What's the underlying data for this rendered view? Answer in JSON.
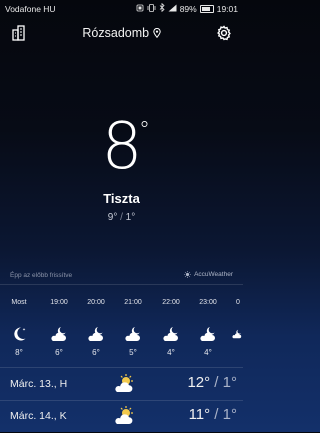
{
  "status": {
    "carrier": "Vodafone HU",
    "battery": "89%",
    "time": "19:01",
    "icons": [
      "notification-icon",
      "vibrate-icon",
      "bluetooth-icon",
      "signal-icon",
      "battery-icon"
    ]
  },
  "header": {
    "location": "Rózsadomb",
    "icons": [
      "cityscape-icon",
      "location-pin-icon",
      "settings-gear-icon"
    ]
  },
  "current": {
    "temp": "8",
    "deg": "°",
    "condition": "Tiszta",
    "high": "9°",
    "low": "1°"
  },
  "updated": "Épp az előbb frissítve",
  "provider": "AccuWeather",
  "hourly": [
    {
      "time": "Most",
      "icon": "moon-icon",
      "temp": "8°"
    },
    {
      "time": "19:00",
      "icon": "cloudy-night-icon",
      "temp": "6°"
    },
    {
      "time": "20:00",
      "icon": "cloudy-night-icon",
      "temp": "6°"
    },
    {
      "time": "21:00",
      "icon": "cloudy-night-icon",
      "temp": "5°"
    },
    {
      "time": "22:00",
      "icon": "cloudy-night-icon",
      "temp": "4°"
    },
    {
      "time": "23:00",
      "icon": "cloudy-night-icon",
      "temp": "4°"
    },
    {
      "time": "0",
      "icon": "cloudy-night-icon",
      "temp": ""
    }
  ],
  "daily": [
    {
      "day": "Márc. 13., H",
      "icon": "partly-cloudy-icon",
      "high": "12°",
      "low": "1°"
    },
    {
      "day": "Márc. 14., K",
      "icon": "partly-cloudy-icon",
      "high": "11°",
      "low": "1°"
    }
  ],
  "colors": {
    "sun": "#f2c94c",
    "text": "#ffffff",
    "muted": "#aab3c9"
  }
}
